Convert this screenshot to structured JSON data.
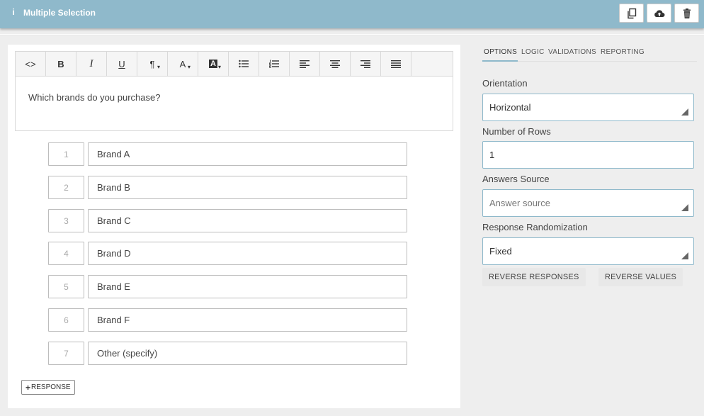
{
  "header": {
    "title": "Multiple Selection",
    "info_glyph": "i",
    "buttons": [
      {
        "icon": "copy-icon"
      },
      {
        "icon": "cloud-upload-icon"
      },
      {
        "icon": "trash-icon"
      }
    ]
  },
  "editor": {
    "toolbar": [
      {
        "icon": "code-icon",
        "glyph": "<>"
      },
      {
        "icon": "bold-icon",
        "glyph": "B"
      },
      {
        "icon": "italic-icon",
        "glyph": "I"
      },
      {
        "icon": "underline-icon",
        "glyph": "U"
      },
      {
        "icon": "paragraph-icon",
        "glyph": "¶"
      },
      {
        "icon": "font-color-icon",
        "glyph": "A"
      },
      {
        "icon": "background-color-icon",
        "glyph": "A"
      },
      {
        "icon": "bullet-list-icon"
      },
      {
        "icon": "numbered-list-icon"
      },
      {
        "icon": "align-left-icon"
      },
      {
        "icon": "align-center-icon"
      },
      {
        "icon": "align-right-icon"
      },
      {
        "icon": "justify-icon"
      }
    ],
    "question_text": "Which brands do you purchase?"
  },
  "responses": [
    {
      "num": "1",
      "text": "Brand A"
    },
    {
      "num": "2",
      "text": "Brand B"
    },
    {
      "num": "3",
      "text": "Brand C"
    },
    {
      "num": "4",
      "text": "Brand D"
    },
    {
      "num": "5",
      "text": "Brand E"
    },
    {
      "num": "6",
      "text": "Brand F"
    },
    {
      "num": "7",
      "text": "Other (specify)"
    }
  ],
  "add_response_label": "RESPONSE",
  "add_response_glyph": "+",
  "tabs": [
    "OPTIONS",
    "LOGIC",
    "VALIDATIONS",
    "REPORTING"
  ],
  "active_tab": "OPTIONS",
  "options": {
    "orientation": {
      "label": "Orientation",
      "value": "Horizontal"
    },
    "rows": {
      "label": "Number of Rows",
      "value": "1"
    },
    "answers_source": {
      "label": "Answers Source",
      "placeholder": "Answer source"
    },
    "randomization": {
      "label": "Response Randomization",
      "value": "Fixed"
    },
    "reverse_responses": "REVERSE RESPONSES",
    "reverse_values": "REVERSE VALUES"
  },
  "colors": {
    "accent": "#8fb9cb",
    "background": "#eeeeee"
  }
}
